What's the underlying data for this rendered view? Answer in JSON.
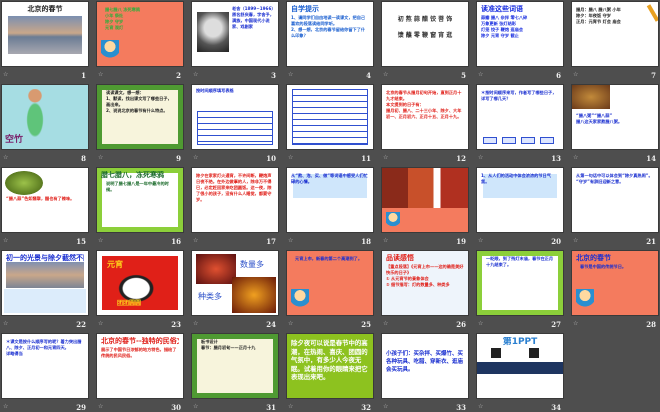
{
  "app": {
    "view": "slide-sorter",
    "slide_count": 34
  },
  "slides": [
    {
      "num": "1",
      "bg": "#ffffff",
      "color": "#222222",
      "title": "北京的春节",
      "deco": "photo-wide",
      "lines": []
    },
    {
      "num": "2",
      "bg": "#f47b5e",
      "color": "#2fae3c",
      "title": "",
      "deco": "cartoon",
      "lines": [
        "腊七腊八 冻死寒鸦",
        "小年 祭灶",
        "除夕 守岁",
        "元宵 观灯"
      ]
    },
    {
      "num": "3",
      "bg": "#ffffff",
      "color": "#1a2fd0",
      "title": "",
      "deco": "portrait",
      "lines": [
        "老舍（1899~1966）原名舒庆春，字舍予，满族，中国现代小说家、戏剧家"
      ]
    },
    {
      "num": "4",
      "bg": "#ffffff",
      "color": "#1a5fd0",
      "title": "自学提示",
      "deco": "",
      "lines": [
        "1、请同学们自由地读一读课文，把自己喜欢的段落读给同学听。",
        "2、想一想，北京的春节留给你留下了什么印象？"
      ]
    },
    {
      "num": "5",
      "bg": "#ffffff",
      "color": "#333333",
      "title": "",
      "deco": "chars",
      "lines": [
        "初 熬 蒜 醋 饺 菩 饰",
        "馈 蘸 零 鞭 窗 宵 逛"
      ]
    },
    {
      "num": "6",
      "bg": "#ffffff",
      "color": "#1a2fe0",
      "title": "读准这些词语",
      "deco": "",
      "lines": [
        "蒜瓣 腊八 杂拌 零七八碎",
        "万象更新 张灯结彩",
        "灯笼 饺子 鞭炮 逛庙会",
        "除夕 元宵 守岁 截止"
      ]
    },
    {
      "num": "7",
      "bg": "#ffffff",
      "color": "#222222",
      "title": "",
      "deco": "pencil",
      "lines": [
        "腊月：腊八 腊八粥 小年",
        "除夕：年夜饭 守岁",
        "正月：元宵节 灯会 庙会"
      ]
    },
    {
      "num": "8",
      "bg": "#a6dde3",
      "color": "#7a1f6a",
      "title": "",
      "deco": "dancer",
      "caption": "空竹",
      "lines": []
    },
    {
      "num": "9",
      "bg": "#f7f4dc",
      "color": "#222222",
      "title": "",
      "deco": "leaf",
      "lines": [
        "读读课文，想一想：",
        "1、默读，找出课文写了哪些日子，画出来。",
        "2、说说北京的春节有什么特点。"
      ]
    },
    {
      "num": "10",
      "bg": "#ffffff",
      "color": "#1a2fd0",
      "title": "",
      "deco": "table",
      "lines": [
        "按时间顺序填写表格"
      ]
    },
    {
      "num": "11",
      "bg": "#ffffff",
      "color": "#1a2fd0",
      "title": "",
      "deco": "table-full",
      "lines": []
    },
    {
      "num": "12",
      "bg": "#ffffff",
      "color": "#e0201a",
      "title": "",
      "deco": "",
      "lines": [
        "北京的春节从腊月初旬开始，直到正月十九才结束。",
        "本文提到的日子有：",
        "腊月初、腊八、二十三小年、除夕、大年初一、正月初六、正月十五、正月十九。"
      ]
    },
    {
      "num": "13",
      "bg": "#ffffff",
      "color": "#1a2fd0",
      "title": "",
      "deco": "buttons",
      "lines": [
        "＊按时间顺序来写，作者写了哪些日子，详写了哪几天？"
      ]
    },
    {
      "num": "14",
      "bg": "#ffffff",
      "color": "#1a2fd0",
      "title": "",
      "deco": "food",
      "lines": [
        "“腊八粥”“腊八蒜”",
        "腊八这天家家熬腊八粥。"
      ]
    },
    {
      "num": "15",
      "bg": "#ffffff",
      "color": "#e0201a",
      "title": "",
      "deco": "food-green",
      "lines": [
        "“腊八蒜”色如翡翠，醋也有了辣味。"
      ]
    },
    {
      "num": "16",
      "bg": "#ffffff",
      "color": "#1a6a2a",
      "title": "腊七腊八，冻死寒鸦",
      "deco": "green-frame",
      "lines": [
        "说明了腊七腊八是一年中最冷的时候。"
      ]
    },
    {
      "num": "17",
      "bg": "#ffffff",
      "color": "#e0201a",
      "title": "",
      "deco": "",
      "lines": [
        "除夕在家家灯火通宵，不许间断，鞭炮声日夜不绝。在外边做事的人，除非万不得已，必定赶回家来吃团圆饭。这一夜，除了很小的孩子，没有什么人睡觉，都要守岁。"
      ]
    },
    {
      "num": "18",
      "bg": "#ffffff",
      "color": "#1a2fd0",
      "title": "",
      "deco": "bluebox",
      "lines": [
        "从“熬、泡、买、做”等词语中感受人们忙碌的心情。"
      ]
    },
    {
      "num": "19",
      "bg": "#f47b5e",
      "color": "#ffffff",
      "title": "",
      "deco": "photos-top",
      "lines": []
    },
    {
      "num": "20",
      "bg": "#ffffff",
      "color": "#1a2fd0",
      "title": "",
      "deco": "bluebox",
      "lines": [
        "1、从人们的活动中体会浓浓的节日气氛。"
      ]
    },
    {
      "num": "21",
      "bg": "#ffffff",
      "color": "#1a2fd0",
      "title": "",
      "deco": "",
      "lines": [
        "从第一句话中可以体会到“除夕真热闹”。",
        "“守岁”有辞旧迎新之意。"
      ]
    },
    {
      "num": "22",
      "bg": "#ffffff",
      "color": "#1a2fd0",
      "title": "初一的光景与除夕截然不同",
      "deco": "photo-mid",
      "lines": []
    },
    {
      "num": "23",
      "bg": "#ffffff",
      "color": "#ffd21a",
      "title": "",
      "deco": "yuanxiao",
      "caption": "元宵",
      "caption2": "团团圆圆",
      "lines": []
    },
    {
      "num": "24",
      "bg": "#ffffff",
      "color": "#2a4fc8",
      "title": "",
      "deco": "lanterns",
      "caption": "数量多",
      "caption2": "种类多",
      "lines": []
    },
    {
      "num": "25",
      "bg": "#f47b5e",
      "color": "#1a2fd0",
      "title": "",
      "deco": "cartoon",
      "lines": [
        "元宵上市，新春的第二个高潮到了。"
      ]
    },
    {
      "num": "26",
      "bg": "#eef4fb",
      "color": "#e0201a",
      "title": "品读感悟",
      "deco": "",
      "lines": [
        "【重点段落】《元宵上市——这的确是美好快乐的日子》",
        "① 从元宵节的景象体会",
        "② 细节描写：灯的数量多、种类多"
      ]
    },
    {
      "num": "27",
      "bg": "#ffffff",
      "color": "#1a2fd0",
      "title": "",
      "deco": "green-frame",
      "lines": [
        "一眨眼，到了残灯末庙，春节在正月十九结束了。"
      ]
    },
    {
      "num": "28",
      "bg": "#f47b5e",
      "color": "#1a2fd0",
      "title": "北京的春节",
      "deco": "cartoon",
      "lines": [
        "春节是中国的传统节日。"
      ]
    },
    {
      "num": "29",
      "bg": "#ffffff",
      "color": "#1a2fd0",
      "title": "",
      "deco": "",
      "lines": [
        "＊课文是按什么顺序写的呢？着力突出腊八、除夕、正月初一和元宵四天。",
        "详略得当"
      ]
    },
    {
      "num": "30",
      "bg": "#ffffff",
      "color": "#e0201a",
      "title": "北京的春节--独特的民俗文化",
      "deco": "",
      "lines": [
        "展示了中国节日浓郁的地方特色，描绘了传统的民风民俗。"
      ]
    },
    {
      "num": "31",
      "bg": "#f7f4dc",
      "color": "#222222",
      "title": "",
      "deco": "leaf",
      "lines": [
        "板书设计",
        "春节：腊月初旬——正月十九"
      ]
    },
    {
      "num": "32",
      "bg": "#8dc21f",
      "color": "#ffffff",
      "title": "",
      "deco": "",
      "lines": [
        "除夕夜可以说是春节中的高潮，在热闹、喜庆、团圆的气氛中，有多少人今夜无眠。试着用你的眼睛来把它表现出来吧。"
      ]
    },
    {
      "num": "33",
      "bg": "#ffffff",
      "color": "#1a2fd0",
      "title": "",
      "deco": "",
      "lines": [
        "小孩子们：买杂拌、买爆竹、买各种玩具、吃腊、穿新衣、逛庙会买玩具。"
      ]
    },
    {
      "num": "34",
      "bg": "#ffffff",
      "color": "#2a7fd0",
      "title": "第1PPT",
      "deco": "ppt-ad",
      "lines": []
    }
  ]
}
